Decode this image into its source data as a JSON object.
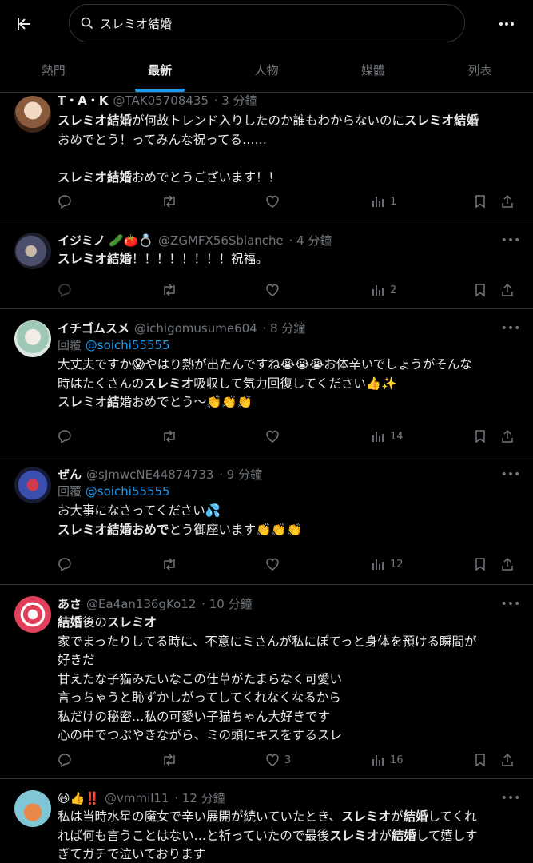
{
  "search": {
    "query": "スレミオ結婚"
  },
  "tabs": [
    {
      "label": "熱門"
    },
    {
      "label": "最新"
    },
    {
      "label": "人物"
    },
    {
      "label": "媒體"
    },
    {
      "label": "列表"
    }
  ],
  "tweets": [
    {
      "name": "T・A・K",
      "handle": "@TAK05708435",
      "time": "· 3 分鐘",
      "views": "1",
      "likes": "",
      "lines": [
        [
          {
            "t": "スレミオ結婚",
            "b": true
          },
          {
            "t": "が何故トレンド入りしたのか誰もわからないのに"
          },
          {
            "t": "スレミオ結婚",
            "b": true
          }
        ],
        [
          {
            "t": "おめでとう！ってみんな祝ってる……"
          }
        ],
        [
          {
            "t": " "
          }
        ],
        [
          {
            "t": "スレミオ結婚",
            "b": true
          },
          {
            "t": "おめでとうございます！！"
          }
        ]
      ]
    },
    {
      "name": "イジミノ",
      "name_emoji": "🥒🍅💍",
      "handle": "@ZGMFX56Sblanche",
      "time": "· 4 分鐘",
      "views": "2",
      "likes": "",
      "lines": [
        [
          {
            "t": "スレミオ結婚",
            "b": true
          },
          {
            "t": "！！！！！！！！祝福。"
          }
        ]
      ]
    },
    {
      "name": "イチゴムスメ",
      "handle": "@ichigomusume604",
      "time": "· 8 分鐘",
      "reply_label": "回覆",
      "reply_handle": "@soichi55555",
      "views": "14",
      "likes": "",
      "lines": [
        [
          {
            "t": "大丈夫ですか😱やはり熱が出たんですね😭😭😭お体辛いでしょうがそんな"
          }
        ],
        [
          {
            "t": "時はたくさんの"
          },
          {
            "t": "スレミオ",
            "b": true
          },
          {
            "t": "吸収して気力回復してください👍✨"
          }
        ],
        [
          {
            "t": "ス"
          },
          {
            "t": "レ",
            "b": true
          },
          {
            "t": "ミオ"
          },
          {
            "t": "結",
            "b": true
          },
          {
            "t": "婚おめでとう〜👏👏👏"
          }
        ]
      ]
    },
    {
      "name": "ぜん",
      "handle": "@sJmwcNE44874733",
      "time": "· 9 分鐘",
      "reply_label": "回覆",
      "reply_handle": "@soichi55555",
      "views": "12",
      "likes": "",
      "lines": [
        [
          {
            "t": "お大事になさってください💦"
          }
        ],
        [
          {
            "t": "スレミオ結婚おめで",
            "b": true
          },
          {
            "t": "とう御座います👏👏👏"
          }
        ]
      ]
    },
    {
      "name": "あさ",
      "handle": "@Ea4an136gKo12",
      "time": "· 10 分鐘",
      "views": "16",
      "likes": "3",
      "lines": [
        [
          {
            "t": "結婚",
            "b": true
          },
          {
            "t": "後の"
          },
          {
            "t": "スレミオ",
            "b": true
          }
        ],
        [
          {
            "t": "家でまったりしてる時に、不意にミさんが私にぽてっと身体を預ける瞬間が"
          }
        ],
        [
          {
            "t": "好きだ"
          }
        ],
        [
          {
            "t": "甘えたな子猫みたいなこの仕草がたまらなく可愛い"
          }
        ],
        [
          {
            "t": "言っちゃうと恥ずかしがってしてくれなくなるから"
          }
        ],
        [
          {
            "t": "私だけの秘密…私の可愛い子猫ちゃん大好きです"
          }
        ],
        [
          {
            "t": "心の中でつぶやきながら、ミの頭にキスをするスレ"
          }
        ]
      ]
    },
    {
      "name": "😃👍‼️",
      "handle": "@vmmil11",
      "time": "· 12 分鐘",
      "views": "",
      "likes": "",
      "lines": [
        [
          {
            "t": "私は当時水星の魔女で辛い展開が続いていたとき、"
          },
          {
            "t": "スレミオ",
            "b": true
          },
          {
            "t": "が"
          },
          {
            "t": "結婚",
            "b": true
          },
          {
            "t": "してくれ"
          }
        ],
        [
          {
            "t": "れば何も言うことはない…と祈っていたので最後"
          },
          {
            "t": "スレミオ",
            "b": true
          },
          {
            "t": "が"
          },
          {
            "t": "結婚",
            "b": true
          },
          {
            "t": "して嬉しす"
          }
        ],
        [
          {
            "t": "ぎてガチで泣いております"
          }
        ]
      ]
    }
  ],
  "colors": {
    "accent": "#1d9bf0",
    "muted": "#71767b",
    "text": "#e7e9ea",
    "border": "#2f3336"
  },
  "icons": [
    "back-arrow-icon",
    "search-icon",
    "more-icon",
    "reply-icon",
    "retweet-icon",
    "like-icon",
    "views-icon",
    "bookmark-icon",
    "share-icon"
  ]
}
